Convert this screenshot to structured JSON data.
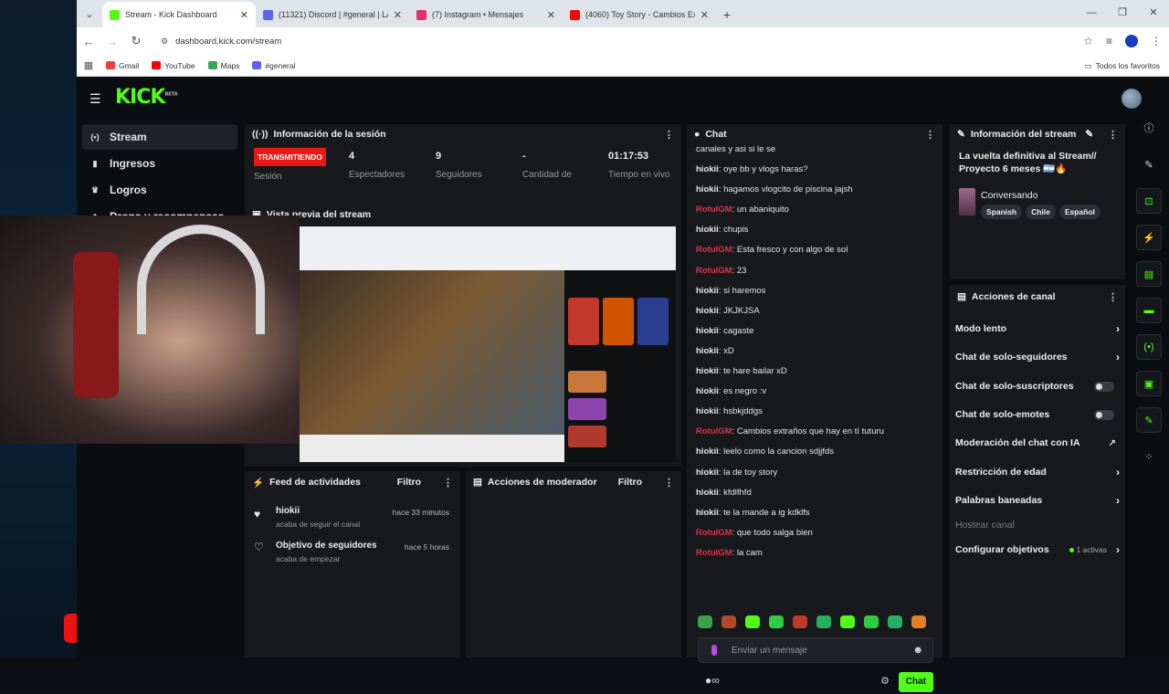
{
  "browser": {
    "tabs": [
      {
        "title": "Stream - Kick Dashboard",
        "color": "#53fc18",
        "active": true
      },
      {
        "title": "(11321) Discord | #general | LA",
        "color": "#5865f2",
        "active": false
      },
      {
        "title": "(7) Instagram • Mensajes",
        "color": "#e1306c",
        "active": false
      },
      {
        "title": "(4060) Toy Story - Cambios Extr",
        "color": "#ff0000",
        "active": false
      }
    ],
    "url": "dashboard.kick.com/stream",
    "bookmarks": [
      {
        "label": "Gmail",
        "color": "#ea4335"
      },
      {
        "label": "YouTube",
        "color": "#ff0000"
      },
      {
        "label": "Maps",
        "color": "#34a853"
      },
      {
        "label": "#general",
        "color": "#5865f2"
      }
    ],
    "all_bookmarks": "Todos los favoritos"
  },
  "kick": {
    "logo": "KICK",
    "logo_beta": "BETA",
    "nav": [
      "Stream",
      "Ingresos",
      "Logros",
      "Drops y recompensas"
    ],
    "session": {
      "title": "Información de la sesión",
      "live_badge": "TRANSMITIENDO",
      "live_label": "Sesión",
      "viewers": "4",
      "viewers_label": "Espectadores",
      "followers": "9",
      "followers_label": "Seguidores",
      "subs": "-",
      "subs_label": "Cantidad de suscripciones",
      "time": "01:17:53",
      "time_label": "Tiempo en vivo"
    },
    "preview_title": "Vista previa del stream",
    "feed": {
      "title": "Feed de actividades",
      "filter": "Filtro",
      "items": [
        {
          "title": "hiokii",
          "sub": "acaba de seguir el canal",
          "time": "hace 33 minutos"
        },
        {
          "title": "Objetivo de seguidores",
          "sub": "acaba de empezar",
          "time": "hace 5 horas"
        }
      ]
    },
    "moderator": {
      "title": "Acciones de moderador",
      "filter": "Filtro"
    },
    "chat": {
      "title": "Chat",
      "messages": [
        {
          "user": "",
          "text": "canales y asi si le se",
          "color": "#e6e6e6"
        },
        {
          "user": "hiokii",
          "text": "oye bb y vlogs haras?",
          "color": "#e6e6e6"
        },
        {
          "user": "hiokii",
          "text": "hagamos vlogcito de piscina jajsh",
          "color": "#e6e6e6"
        },
        {
          "user": "RotuIGM",
          "text": "un abaniquito",
          "color": "#e0314b"
        },
        {
          "user": "hiokii",
          "text": "chupis",
          "color": "#e6e6e6"
        },
        {
          "user": "RotuIGM",
          "text": "Esta fresco y con algo de sol",
          "color": "#e0314b"
        },
        {
          "user": "RotuIGM",
          "text": "23",
          "color": "#e0314b"
        },
        {
          "user": "hiokii",
          "text": "si haremos",
          "color": "#e6e6e6"
        },
        {
          "user": "hiokii",
          "text": "JKJKJSA",
          "color": "#e6e6e6"
        },
        {
          "user": "hiokii",
          "text": "cagaste",
          "color": "#e6e6e6"
        },
        {
          "user": "hiokii",
          "text": "xD",
          "color": "#e6e6e6"
        },
        {
          "user": "hiokii",
          "text": "te hare bailar xD",
          "color": "#e6e6e6"
        },
        {
          "user": "hiokii",
          "text": "es negro :v",
          "color": "#e6e6e6"
        },
        {
          "user": "hiokii",
          "text": "hsbkjddgs",
          "color": "#e6e6e6"
        },
        {
          "user": "RotuIGM",
          "text": "Cambios extraños que hay en tí tuturu",
          "color": "#e0314b"
        },
        {
          "user": "hiokii",
          "text": "leelo como la cancion sdjjfds",
          "color": "#e6e6e6"
        },
        {
          "user": "hiokii",
          "text": "la de toy story",
          "color": "#e6e6e6"
        },
        {
          "user": "hiokii",
          "text": "kfdlfhfd",
          "color": "#e6e6e6"
        },
        {
          "user": "hiokii",
          "text": "te la mande a ig kdklfs",
          "color": "#e6e6e6"
        },
        {
          "user": "RotuIGM",
          "text": "que todo salga bien",
          "color": "#e0314b"
        },
        {
          "user": "RotuIGM",
          "text": "la cam",
          "color": "#e0314b"
        }
      ],
      "emote_colors": [
        "#3aa14c",
        "#b24a2a",
        "#53fc18",
        "#2ecc40",
        "#c0392b",
        "#27ae60",
        "#53fc18",
        "#2ecc40",
        "#27ae60",
        "#e67e22"
      ],
      "placeholder": "Enviar un mensaje",
      "send": "Chat"
    },
    "stream_info": {
      "title": "Información del stream",
      "stream_title": "La vuelta definitiva al Stream// Proyecto 6 meses 🇦🇷🔥",
      "category": "Conversando",
      "tags": [
        "Spanish",
        "Chile",
        "Español"
      ]
    },
    "channel_actions": {
      "title": "Acciones de canal",
      "items": [
        {
          "label": "Modo lento",
          "control": "chevron"
        },
        {
          "label": "Chat de solo-seguidores",
          "control": "chevron"
        },
        {
          "label": "Chat de solo-suscriptores",
          "control": "toggle"
        },
        {
          "label": "Chat de solo-emotes",
          "control": "toggle"
        },
        {
          "label": "Moderación del chat con IA",
          "control": "external"
        },
        {
          "label": "Restricción de edad",
          "control": "chevron"
        },
        {
          "label": "Palabras baneadas",
          "control": "chevron"
        },
        {
          "label": "Hostear canal",
          "control": "none"
        },
        {
          "label": "Configurar objetivos",
          "control": "chevron",
          "extra": "1 activas"
        }
      ]
    }
  },
  "colors": {
    "accent": "#53fc18",
    "live": "#e91916",
    "panel": "#17191c",
    "bg": "#0b0e11"
  }
}
